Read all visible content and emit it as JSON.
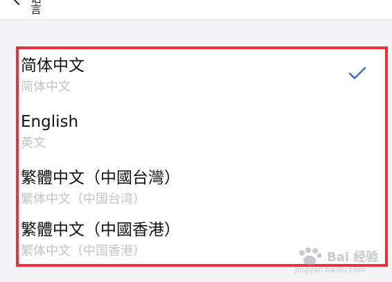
{
  "header": {
    "back_icon": "chevron-left-icon",
    "title_fragment": "语言"
  },
  "languages": [
    {
      "name": "简体中文",
      "subtitle": "简体中文",
      "selected": true
    },
    {
      "name": "English",
      "subtitle": "英文",
      "selected": false
    },
    {
      "name": "繁體中文（中國台灣）",
      "subtitle": "繁体中文（中国台湾）",
      "selected": false
    },
    {
      "name": "繁體中文（中國香港）",
      "subtitle": "繁体中文（中国香港）",
      "selected": false
    }
  ],
  "selected_icon": "checkmark-icon",
  "colors": {
    "highlight_border": "#ef2f3c",
    "check": "#3a6fe2",
    "primary_text": "#111111",
    "secondary_text": "#c3c3c8"
  },
  "watermark": {
    "text": "Bai 经验",
    "sub": "jingyan.baidu.com"
  }
}
